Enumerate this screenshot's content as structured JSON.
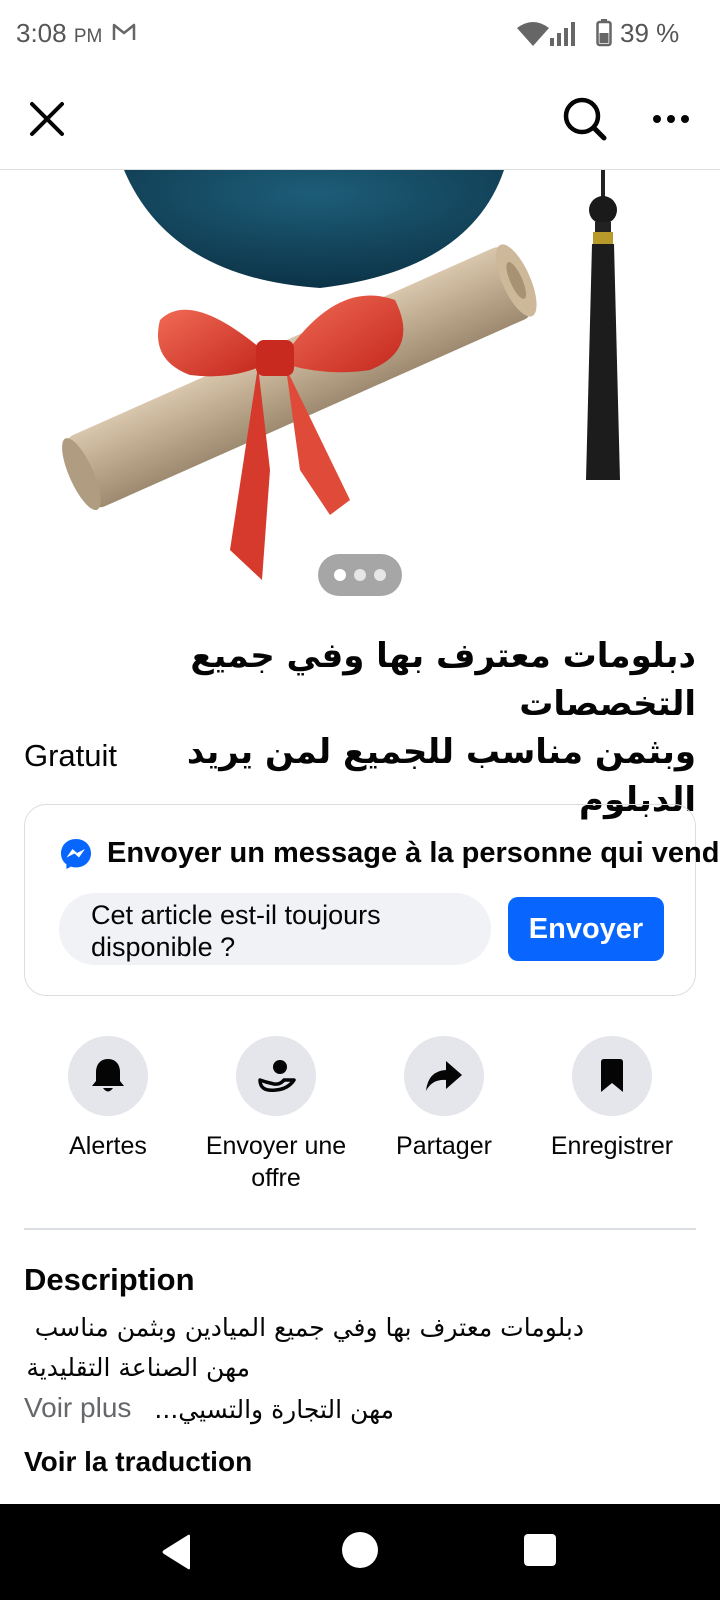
{
  "status_bar": {
    "time": "3:08",
    "ampm": "PM",
    "battery": "39 %"
  },
  "top_bar": {
    "icons": [
      "close-icon",
      "search-icon",
      "more-icon"
    ]
  },
  "carousel": {
    "page_count": 3,
    "active_index": 0
  },
  "listing": {
    "title_line1": "دبلومات معترف بها وفي جميع التخصصات",
    "title_line2": "وبثمن مناسب للجميع لمن يريد الدبلوم",
    "price": "Gratuit"
  },
  "message_card": {
    "heading": "Envoyer un message à la personne qui vend",
    "input_value_line1": "Cet article est-il toujours",
    "input_value_line2": "disponible ?",
    "send_label": "Envoyer"
  },
  "actions": [
    {
      "label_line1": "Alertes",
      "label_line2": "",
      "icon": "bell-icon"
    },
    {
      "label_line1": "Envoyer une",
      "label_line2": "offre",
      "icon": "offer-icon"
    },
    {
      "label_line1": "Partager",
      "label_line2": "",
      "icon": "share-icon"
    },
    {
      "label_line1": "Enregistrer",
      "label_line2": "",
      "icon": "bookmark-icon"
    }
  ],
  "description": {
    "heading": "Description",
    "line1": "دبلومات معترف بها وفي جميع الميادين وبثمن مناسب",
    "line2": "مهن الصناعة التقليدية",
    "line3": "مهن التجارة والتسيي...",
    "more_label": "Voir plus",
    "translate_label": "Voir la traduction"
  },
  "colors": {
    "accent": "#0866ff",
    "icon_bg": "#e4e6eb",
    "secondary_text": "#65676b"
  }
}
